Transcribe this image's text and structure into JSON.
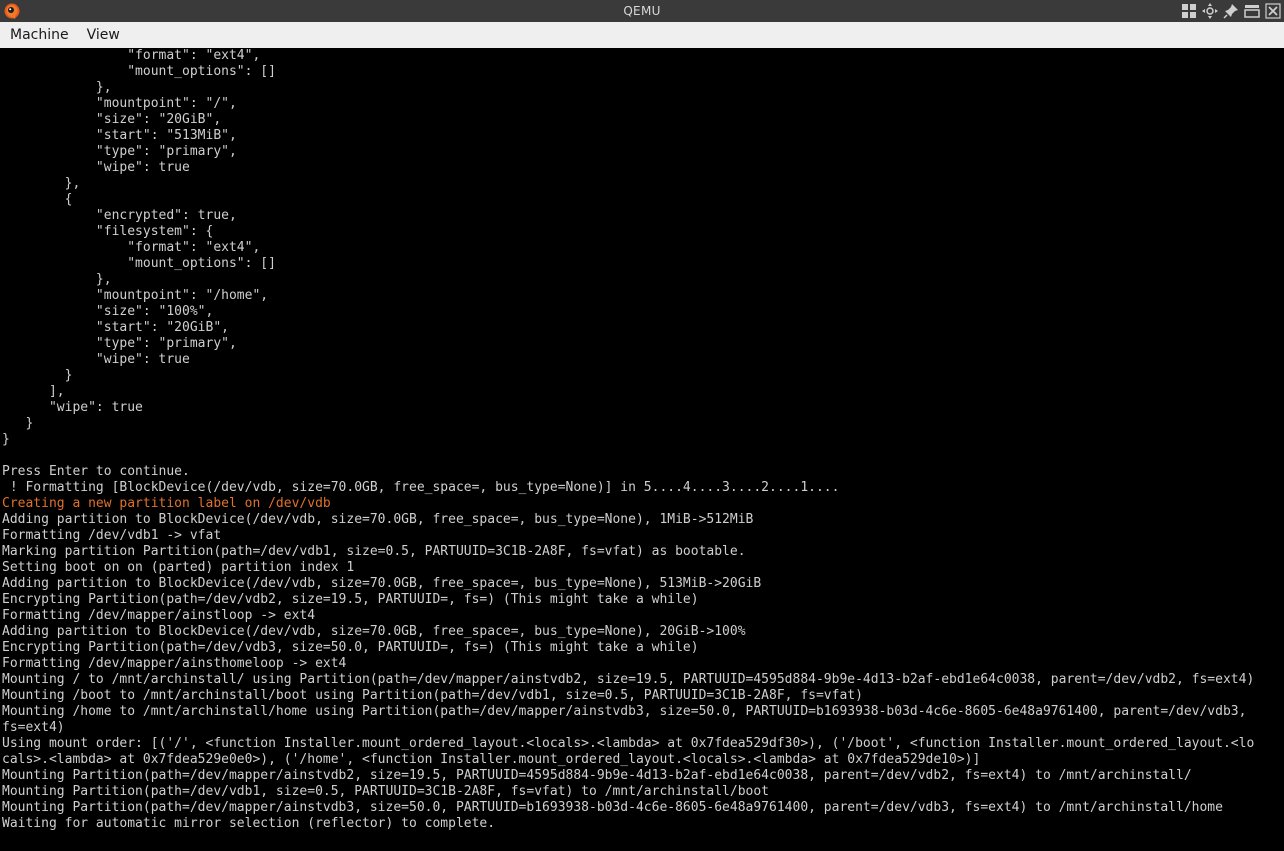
{
  "window": {
    "title": "QEMU"
  },
  "menubar": {
    "items": [
      "Machine",
      "View"
    ]
  },
  "icons": {
    "app": "qemu-logo-icon",
    "controls": [
      "tile-windows-icon",
      "move-window-icon",
      "pin-icon",
      "minimize-window-icon",
      "close-window-icon"
    ]
  },
  "colors": {
    "terminal_text": "#cfcfcf",
    "terminal_bg": "#000000",
    "warning_text": "#e0712a"
  },
  "terminal": {
    "lines": [
      {
        "text": "                \"format\": \"ext4\",",
        "style": "normal"
      },
      {
        "text": "                \"mount_options\": []",
        "style": "normal"
      },
      {
        "text": "            },",
        "style": "normal"
      },
      {
        "text": "            \"mountpoint\": \"/\",",
        "style": "normal"
      },
      {
        "text": "            \"size\": \"20GiB\",",
        "style": "normal"
      },
      {
        "text": "            \"start\": \"513MiB\",",
        "style": "normal"
      },
      {
        "text": "            \"type\": \"primary\",",
        "style": "normal"
      },
      {
        "text": "            \"wipe\": true",
        "style": "normal"
      },
      {
        "text": "        },",
        "style": "normal"
      },
      {
        "text": "        {",
        "style": "normal"
      },
      {
        "text": "            \"encrypted\": true,",
        "style": "normal"
      },
      {
        "text": "            \"filesystem\": {",
        "style": "normal"
      },
      {
        "text": "                \"format\": \"ext4\",",
        "style": "normal"
      },
      {
        "text": "                \"mount_options\": []",
        "style": "normal"
      },
      {
        "text": "            },",
        "style": "normal"
      },
      {
        "text": "            \"mountpoint\": \"/home\",",
        "style": "normal"
      },
      {
        "text": "            \"size\": \"100%\",",
        "style": "normal"
      },
      {
        "text": "            \"start\": \"20GiB\",",
        "style": "normal"
      },
      {
        "text": "            \"type\": \"primary\",",
        "style": "normal"
      },
      {
        "text": "            \"wipe\": true",
        "style": "normal"
      },
      {
        "text": "        }",
        "style": "normal"
      },
      {
        "text": "      ],",
        "style": "normal"
      },
      {
        "text": "      \"wipe\": true",
        "style": "normal"
      },
      {
        "text": "   }",
        "style": "normal"
      },
      {
        "text": "}",
        "style": "normal"
      },
      {
        "text": "",
        "style": "normal"
      },
      {
        "text": "Press Enter to continue.",
        "style": "normal"
      },
      {
        "text": " ! Formatting [BlockDevice(/dev/vdb, size=70.0GB, free_space=, bus_type=None)] in 5....4....3....2....1....",
        "style": "normal"
      },
      {
        "text": "Creating a new partition label on /dev/vdb",
        "style": "warn"
      },
      {
        "text": "Adding partition to BlockDevice(/dev/vdb, size=70.0GB, free_space=, bus_type=None), 1MiB->512MiB",
        "style": "normal"
      },
      {
        "text": "Formatting /dev/vdb1 -> vfat",
        "style": "normal"
      },
      {
        "text": "Marking partition Partition(path=/dev/vdb1, size=0.5, PARTUUID=3C1B-2A8F, fs=vfat) as bootable.",
        "style": "normal"
      },
      {
        "text": "Setting boot on on (parted) partition index 1",
        "style": "normal"
      },
      {
        "text": "Adding partition to BlockDevice(/dev/vdb, size=70.0GB, free_space=, bus_type=None), 513MiB->20GiB",
        "style": "normal"
      },
      {
        "text": "Encrypting Partition(path=/dev/vdb2, size=19.5, PARTUUID=, fs=) (This might take a while)",
        "style": "normal"
      },
      {
        "text": "Formatting /dev/mapper/ainstloop -> ext4",
        "style": "normal"
      },
      {
        "text": "Adding partition to BlockDevice(/dev/vdb, size=70.0GB, free_space=, bus_type=None), 20GiB->100%",
        "style": "normal"
      },
      {
        "text": "Encrypting Partition(path=/dev/vdb3, size=50.0, PARTUUID=, fs=) (This might take a while)",
        "style": "normal"
      },
      {
        "text": "Formatting /dev/mapper/ainsthomeloop -> ext4",
        "style": "normal"
      },
      {
        "text": "Mounting / to /mnt/archinstall/ using Partition(path=/dev/mapper/ainstvdb2, size=19.5, PARTUUID=4595d884-9b9e-4d13-b2af-ebd1e64c0038, parent=/dev/vdb2, fs=ext4)",
        "style": "normal"
      },
      {
        "text": "Mounting /boot to /mnt/archinstall/boot using Partition(path=/dev/vdb1, size=0.5, PARTUUID=3C1B-2A8F, fs=vfat)",
        "style": "normal"
      },
      {
        "text": "Mounting /home to /mnt/archinstall/home using Partition(path=/dev/mapper/ainstvdb3, size=50.0, PARTUUID=b1693938-b03d-4c6e-8605-6e48a9761400, parent=/dev/vdb3,",
        "style": "normal"
      },
      {
        "text": "fs=ext4)",
        "style": "normal"
      },
      {
        "text": "Using mount order: [('/', <function Installer.mount_ordered_layout.<locals>.<lambda> at 0x7fdea529df30>), ('/boot', <function Installer.mount_ordered_layout.<lo",
        "style": "normal"
      },
      {
        "text": "cals>.<lambda> at 0x7fdea529e0e0>), ('/home', <function Installer.mount_ordered_layout.<locals>.<lambda> at 0x7fdea529de10>)]",
        "style": "normal"
      },
      {
        "text": "Mounting Partition(path=/dev/mapper/ainstvdb2, size=19.5, PARTUUID=4595d884-9b9e-4d13-b2af-ebd1e64c0038, parent=/dev/vdb2, fs=ext4) to /mnt/archinstall/",
        "style": "normal"
      },
      {
        "text": "Mounting Partition(path=/dev/vdb1, size=0.5, PARTUUID=3C1B-2A8F, fs=vfat) to /mnt/archinstall/boot",
        "style": "normal"
      },
      {
        "text": "Mounting Partition(path=/dev/mapper/ainstvdb3, size=50.0, PARTUUID=b1693938-b03d-4c6e-8605-6e48a9761400, parent=/dev/vdb3, fs=ext4) to /mnt/archinstall/home",
        "style": "normal"
      },
      {
        "text": "Waiting for automatic mirror selection (reflector) to complete.",
        "style": "normal"
      }
    ]
  }
}
